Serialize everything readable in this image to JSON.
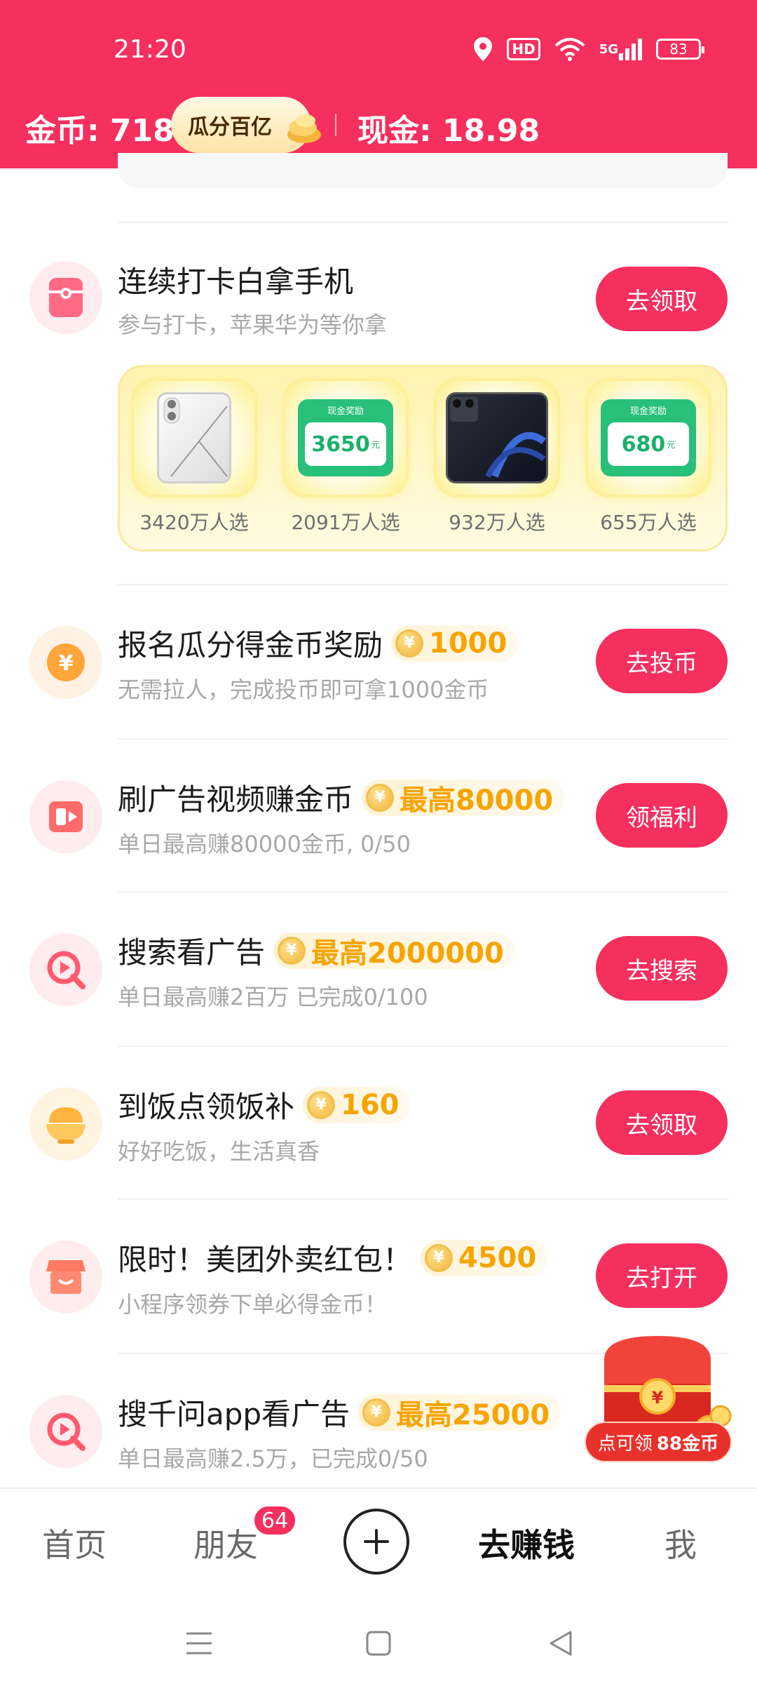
{
  "status_bar": {
    "time": "21:20",
    "hd_label": "HD",
    "network_label": "5G",
    "battery_level": "83"
  },
  "header": {
    "coins_label": "金币: 7181",
    "split_pill_label": "瓜分百亿",
    "cash_label": "现金: 18.98"
  },
  "checkin_task": {
    "icon": "phone-gift-icon",
    "title": "连续打卡白拿手机",
    "subtitle": "参与打卡，苹果华为等你拿",
    "button": "去领取",
    "prizes": [
      {
        "kind": "phone-white",
        "label": "3420万人选"
      },
      {
        "kind": "cash",
        "cash_title": "现金奖励",
        "amount": "3650",
        "unit": "元",
        "label": "2091万人选"
      },
      {
        "kind": "phone-dark",
        "label": "932万人选"
      },
      {
        "kind": "cash",
        "cash_title": "现金奖励",
        "amount": "680",
        "unit": "元",
        "label": "655万人选"
      }
    ]
  },
  "tasks": [
    {
      "icon": "yuan-coin-icon",
      "title": "报名瓜分得金币奖励",
      "reward": "1000",
      "subtitle": "无需拉人，完成投币即可拿1000金币",
      "button": "去投币"
    },
    {
      "icon": "video-play-icon",
      "title": "刷广告视频赚金币",
      "reward": "最高80000",
      "subtitle": "单日最高赚80000金币, 0/50",
      "button": "领福利"
    },
    {
      "icon": "search-play-icon",
      "title": "搜索看广告",
      "reward": "最高2000000",
      "subtitle": "单日最高赚2百万 已完成0/100",
      "button": "去搜索"
    },
    {
      "icon": "rice-bowl-icon",
      "title": "到饭点领饭补",
      "reward": "160",
      "subtitle": "好好吃饭，生活真香",
      "button": "去领取"
    },
    {
      "icon": "shop-icon",
      "title": "限时！美团外卖红包！",
      "reward": "4500",
      "subtitle": "小程序领券下单必得金币！",
      "button": "去打开"
    },
    {
      "icon": "search-play-icon",
      "title": "搜千问app看广告",
      "reward": "最高25000",
      "subtitle": "单日最高赚2.5万，已完成0/50",
      "button": ""
    }
  ],
  "coin_glyph": "¥",
  "floating_chest": {
    "label": "点可领",
    "amount": "88金币"
  },
  "bottom_nav": {
    "home": "首页",
    "friends": "朋友",
    "friends_badge": "64",
    "earn": "去赚钱",
    "me": "我"
  },
  "colors": {
    "brand_red": "#f52f5e",
    "reward_gold": "#f7a400",
    "cash_green": "#28c07a"
  }
}
